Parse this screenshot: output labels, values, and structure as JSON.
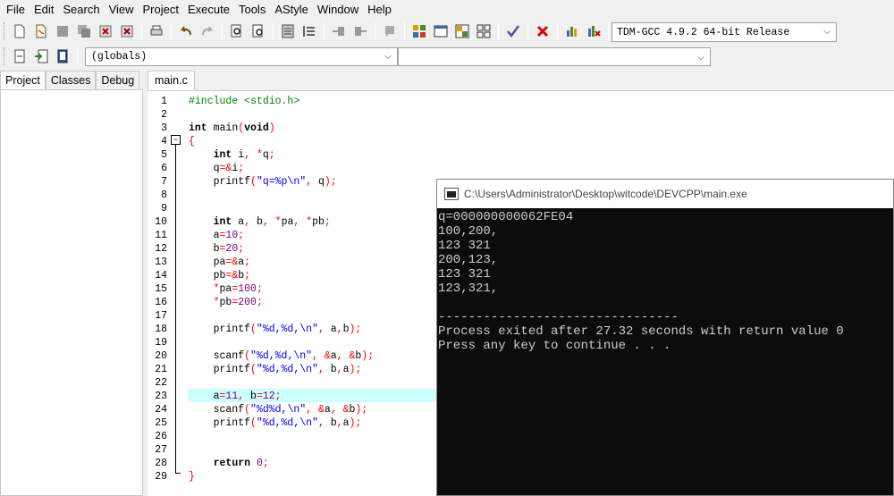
{
  "menu": [
    "File",
    "Edit",
    "Search",
    "View",
    "Project",
    "Execute",
    "Tools",
    "AStyle",
    "Window",
    "Help"
  ],
  "toolbar": {
    "compiler": "TDM-GCC 4.9.2 64-bit Release",
    "globals": "(globals)",
    "icons": [
      "new-file-icon",
      "open-file-icon",
      "save-icon",
      "save-all-icon",
      "close-icon",
      "close-all-icon",
      "print-icon",
      "undo-icon",
      "redo-icon",
      "find-icon",
      "replace-icon",
      "goto-line-icon",
      "goto-function-icon",
      "indent-icon",
      "unindent-icon",
      "toggle-comment-icon",
      "compile-icon",
      "run-icon",
      "compile-run-icon",
      "rebuild-icon",
      "syntax-check-icon",
      "stop-icon",
      "chart-icon",
      "profile-icon"
    ]
  },
  "left_tabs": [
    "Project",
    "Classes",
    "Debug"
  ],
  "editor": {
    "tab": "main.c",
    "highlight_line": 23
  },
  "code_lines": [
    "#include <stdio.h>",
    "",
    "int main(void)",
    "{",
    "    int i, *q;",
    "    q=&i;",
    "    printf(\"q=%p\\n\", q);",
    "",
    "",
    "    int a, b, *pa, *pb;",
    "    a=10;",
    "    b=20;",
    "    pa=&a;",
    "    pb=&b;",
    "    *pa=100;",
    "    *pb=200;",
    "",
    "    printf(\"%d,%d,\\n\", a,b);",
    "",
    "    scanf(\"%d,%d,\\n\", &a, &b);",
    "    printf(\"%d,%d,\\n\", b,a);",
    "",
    "    a=11, b=12;",
    "    scanf(\"%d%d,\\n\", &a, &b);",
    "    printf(\"%d,%d,\\n\", b,a);",
    "",
    "",
    "    return 0;",
    "}"
  ],
  "console": {
    "title": "C:\\Users\\Administrator\\Desktop\\witcode\\DEVCPP\\main.exe",
    "lines": [
      "q=000000000062FE04",
      "100,200,",
      "123 321",
      "200,123,",
      "123 321",
      "123,321,",
      "",
      "--------------------------------",
      "Process exited after 27.32 seconds with return value 0",
      "Press any key to continue . . ."
    ]
  }
}
